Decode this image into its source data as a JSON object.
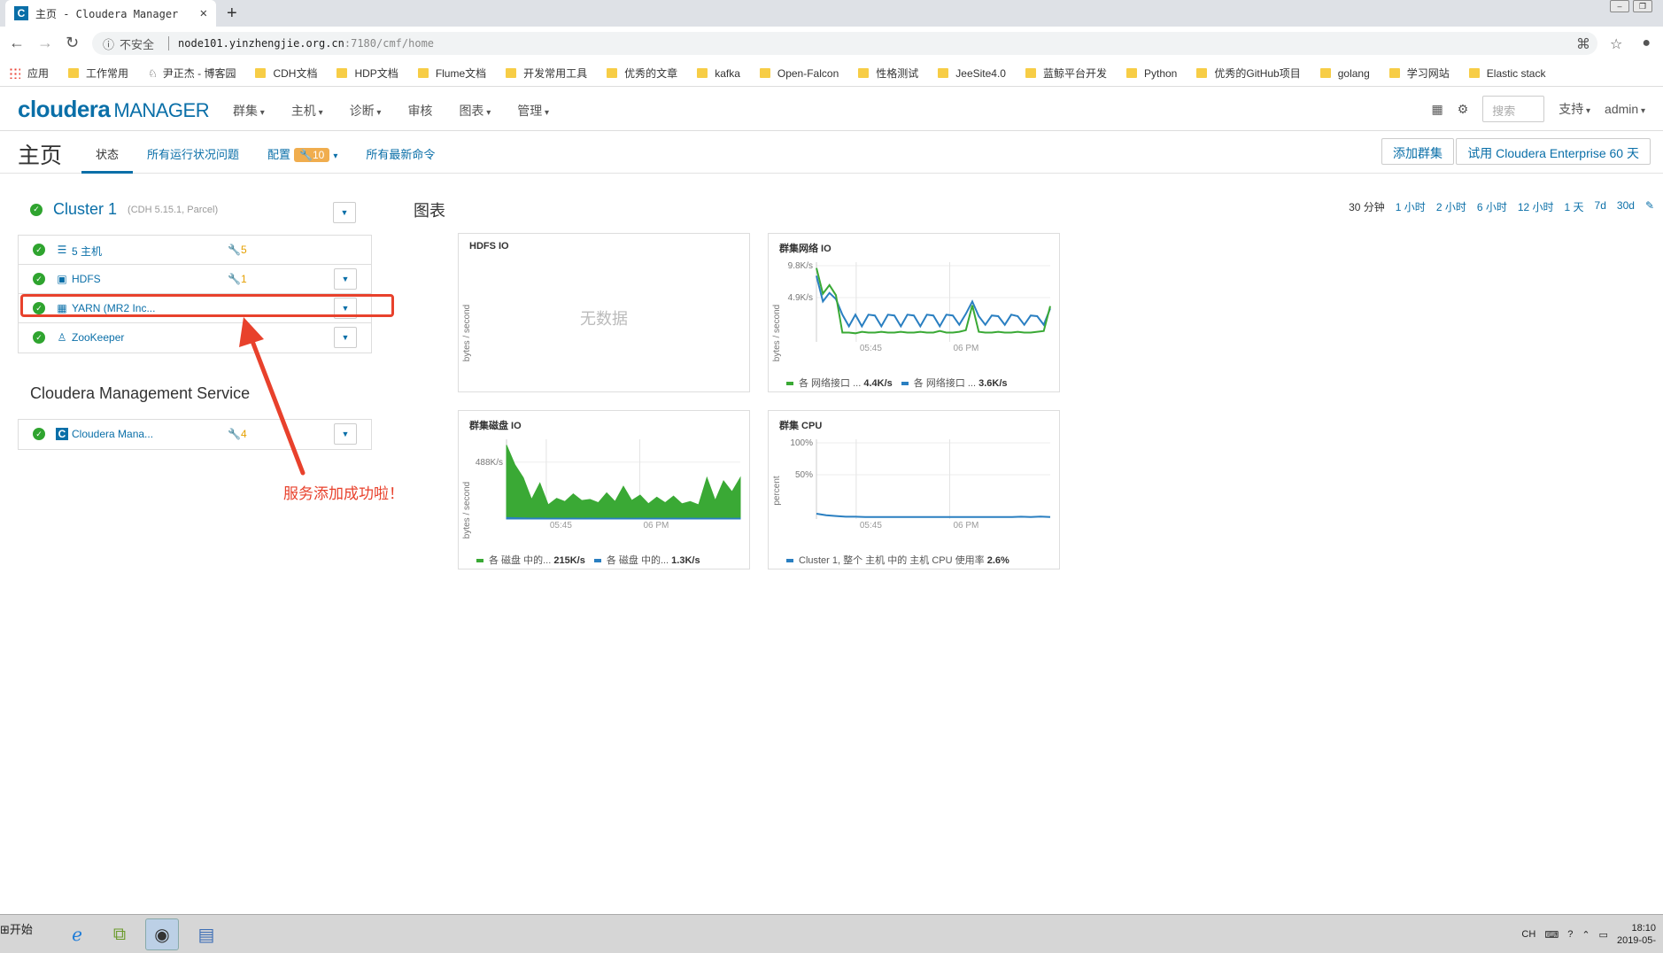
{
  "browser": {
    "tab_title": "主页 - Cloudera Manager",
    "favicon_letter": "C",
    "security": "不安全",
    "url_host": "node101.yinzhengjie.org.cn",
    "url_path": ":7180/cmf/home",
    "bookmarks": [
      {
        "label": "应用",
        "icon": "apps-icon"
      },
      {
        "label": "工作常用",
        "icon": "folder-icon"
      },
      {
        "label": "尹正杰 - 博客园",
        "icon": "blog-icon"
      },
      {
        "label": "CDH文档",
        "icon": "folder-icon"
      },
      {
        "label": "HDP文档",
        "icon": "folder-icon"
      },
      {
        "label": "Flume文档",
        "icon": "folder-icon"
      },
      {
        "label": "开发常用工具",
        "icon": "folder-icon"
      },
      {
        "label": "优秀的文章",
        "icon": "folder-icon"
      },
      {
        "label": "kafka",
        "icon": "folder-icon"
      },
      {
        "label": "Open-Falcon",
        "icon": "folder-icon"
      },
      {
        "label": "性格测试",
        "icon": "folder-icon"
      },
      {
        "label": "JeeSite4.0",
        "icon": "folder-icon"
      },
      {
        "label": "蓝鲸平台开发",
        "icon": "folder-icon"
      },
      {
        "label": "Python",
        "icon": "folder-icon"
      },
      {
        "label": "优秀的GitHub项目",
        "icon": "folder-icon"
      },
      {
        "label": "golang",
        "icon": "folder-icon"
      },
      {
        "label": "学习网站",
        "icon": "folder-icon"
      },
      {
        "label": "Elastic stack",
        "icon": "folder-icon"
      }
    ]
  },
  "header": {
    "logo_brand": "cloudera",
    "logo_product": "MANAGER",
    "menu": [
      {
        "label": "群集",
        "caret": true
      },
      {
        "label": "主机",
        "caret": true
      },
      {
        "label": "诊断",
        "caret": true
      },
      {
        "label": "审核",
        "caret": false
      },
      {
        "label": "图表",
        "caret": true
      },
      {
        "label": "管理",
        "caret": true
      }
    ],
    "search_placeholder": "搜索",
    "support": "支持",
    "user": "admin"
  },
  "page": {
    "title": "主页",
    "tabs": [
      {
        "label": "状态",
        "active": true
      },
      {
        "label": "所有运行状况问题",
        "active": false
      },
      {
        "label": "配置",
        "active": false,
        "badge": "10"
      },
      {
        "label": "所有最新命令",
        "active": false
      }
    ],
    "add_cluster": "添加群集",
    "trial": "试用 Cloudera Enterprise 60 天"
  },
  "cluster": {
    "name": "Cluster 1",
    "version": "(CDH 5.15.1, Parcel)",
    "services": [
      {
        "name": "5 主机",
        "icon": "list-icon",
        "warnings": "5",
        "dropdown": false
      },
      {
        "name": "HDFS",
        "icon": "hdfs-icon",
        "warnings": "1",
        "dropdown": true
      },
      {
        "name": "YARN (MR2 Inc...",
        "icon": "yarn-icon",
        "warnings": "",
        "dropdown": true
      },
      {
        "name": "ZooKeeper",
        "icon": "zookeeper-icon",
        "warnings": "",
        "dropdown": true
      }
    ]
  },
  "cms": {
    "title": "Cloudera Management Service",
    "services": [
      {
        "name": "Cloudera Mana...",
        "icon": "cm-icon",
        "warnings": "4",
        "dropdown": true
      }
    ]
  },
  "annotation": "服务添加成功啦！",
  "charts_section": {
    "title": "图表",
    "ranges": [
      "30 分钟",
      "1 小时",
      "2 小时",
      "6 小时",
      "12 小时",
      "1 天",
      "7d",
      "30d"
    ],
    "current_range": "30 分钟"
  },
  "colors": {
    "accent": "#0a6fa8",
    "ok": "#2fa42f",
    "warn": "#e5a000",
    "highlight": "#e8412c",
    "series_green": "#3aa935",
    "series_blue": "#2a7fc1"
  },
  "chart_data": [
    {
      "type": "line",
      "title": "HDFS IO",
      "ylabel": "bytes / second",
      "no_data": "无数据",
      "series": []
    },
    {
      "type": "line",
      "title": "群集网络 IO",
      "ylabel": "bytes / second",
      "y_ticks": [
        "9.8K/s",
        "4.9K/s"
      ],
      "x_ticks": [
        "05:45",
        "06 PM"
      ],
      "ylim": [
        0,
        9800
      ],
      "series": [
        {
          "name": "各 网络接口 ...",
          "color": "green",
          "legend_value": "4.4K/s",
          "values": [
            9500,
            6200,
            7300,
            6000,
            1200,
            1200,
            1100,
            1300,
            1200,
            1200,
            1300,
            1200,
            1200,
            1300,
            1200,
            1200,
            1300,
            1200,
            1200,
            1400,
            1200,
            1200,
            1300,
            1500,
            4700,
            1300,
            1200,
            1200,
            1300,
            1200,
            1200,
            1300,
            1200,
            1200,
            1300,
            1400,
            4600
          ]
        },
        {
          "name": "各 网络接口 ...",
          "color": "blue",
          "legend_value": "3.6K/s",
          "values": [
            8500,
            5200,
            6300,
            5500,
            3500,
            2000,
            3500,
            2000,
            3500,
            3400,
            2000,
            3500,
            3400,
            2000,
            3500,
            3400,
            2000,
            3500,
            3400,
            2000,
            3500,
            3400,
            2200,
            3600,
            5200,
            3300,
            2200,
            3400,
            3300,
            2200,
            3500,
            3300,
            2200,
            3400,
            3300,
            2200,
            4300
          ]
        }
      ]
    },
    {
      "type": "area",
      "title": "群集磁盘 IO",
      "ylabel": "bytes / second",
      "y_ticks": [
        "488K/s"
      ],
      "x_ticks": [
        "05:45",
        "06 PM"
      ],
      "ylim": [
        0,
        700000
      ],
      "series": [
        {
          "name": "各 磁盘 中的...",
          "color": "green",
          "legend_value": "215K/s",
          "values": [
            680000,
            500000,
            380000,
            180000,
            330000,
            130000,
            190000,
            160000,
            230000,
            170000,
            180000,
            150000,
            240000,
            160000,
            300000,
            170000,
            220000,
            140000,
            200000,
            150000,
            210000,
            140000,
            160000,
            130000,
            380000,
            170000,
            350000,
            250000,
            380000
          ]
        },
        {
          "name": "各 磁盘 中的...",
          "color": "blue",
          "legend_value": "1.3K/s",
          "values": [
            15000,
            12000,
            10000,
            8000,
            9000,
            7000,
            8000,
            7000,
            8000,
            7000,
            8000,
            7000,
            8000,
            7000,
            8000,
            7000,
            8000,
            7000,
            8000,
            7000,
            8000,
            7000,
            8000,
            7000,
            8000,
            7000,
            8000,
            7000,
            8000
          ]
        }
      ]
    },
    {
      "type": "line",
      "title": "群集 CPU",
      "ylabel": "percent",
      "y_ticks": [
        "100%",
        "50%"
      ],
      "x_ticks": [
        "05:45",
        "06 PM"
      ],
      "ylim": [
        0,
        100
      ],
      "series": [
        {
          "name": "Cluster 1, 整个 主机 中的 主机 CPU 使用率",
          "color": "blue",
          "legend_value": "2.6%",
          "values": [
            7,
            5,
            4,
            3,
            3,
            2.6,
            2.6,
            2.6,
            2.5,
            2.5,
            2.6,
            2.6,
            2.5,
            2.5,
            2.6,
            2.6,
            2.5,
            2.6,
            2.6,
            2.6,
            2.5,
            3,
            2.6,
            3.2,
            2.6
          ]
        }
      ]
    }
  ],
  "taskbar": {
    "start": "开始",
    "lang": "CH",
    "time": "18:10",
    "date": "2019-05-"
  }
}
